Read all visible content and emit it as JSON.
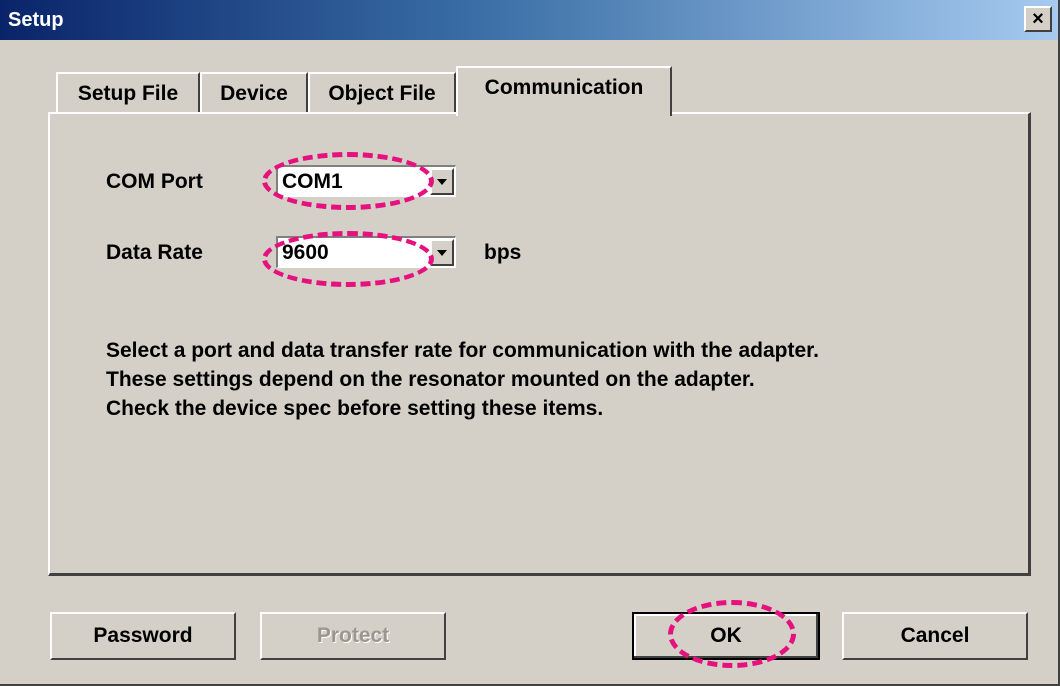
{
  "window": {
    "title": "Setup",
    "close_symbol": "×"
  },
  "tabs": [
    {
      "label": "Setup File",
      "active": false
    },
    {
      "label": "Device",
      "active": false
    },
    {
      "label": "Object File",
      "active": false
    },
    {
      "label": "Communication",
      "active": true
    }
  ],
  "communication": {
    "com_port_label": "COM Port",
    "com_port_value": "COM1",
    "data_rate_label": "Data Rate",
    "data_rate_value": "9600",
    "data_rate_unit": "bps",
    "description": [
      "Select a port and data transfer rate for communication with the adapter.",
      "These settings depend on the resonator mounted on the adapter.",
      "Check the device spec before setting these items."
    ]
  },
  "buttons": {
    "password": "Password",
    "protect": "Protect",
    "ok": "OK",
    "cancel": "Cancel"
  },
  "colors": {
    "highlight": "#e6117e",
    "title_gradient_start": "#0a246a",
    "title_gradient_end": "#a6caf0",
    "dialog_face": "#d4d0c8"
  }
}
